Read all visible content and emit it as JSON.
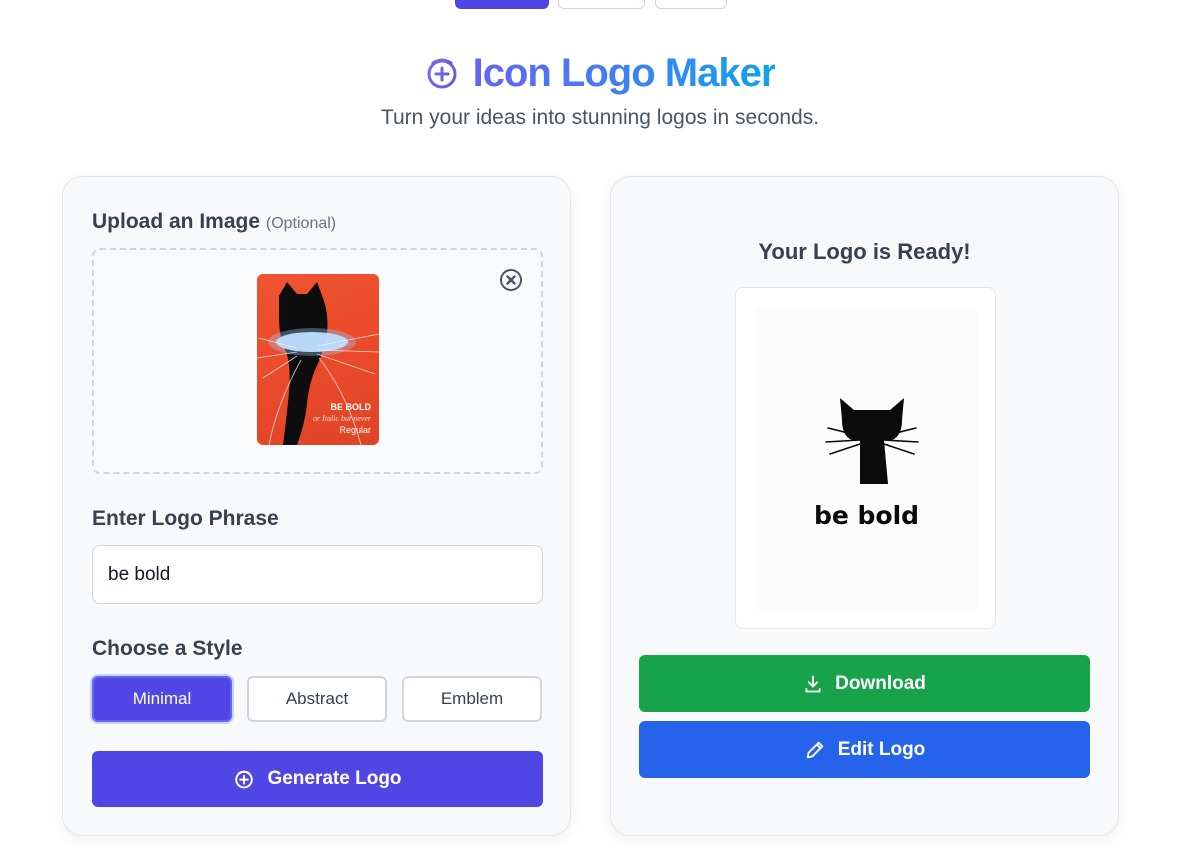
{
  "app": {
    "title": "Icon Logo Maker",
    "subtitle": "Turn your ideas into stunning logos in seconds."
  },
  "upload": {
    "label": "Upload an Image",
    "optional": "(Optional)",
    "thumbnail_text": {
      "line1": "BE BOLD",
      "line2": "or Italic but never",
      "line3": "Regular"
    }
  },
  "phrase": {
    "label": "Enter Logo Phrase",
    "value": "be bold"
  },
  "style": {
    "label": "Choose a Style",
    "options": [
      "Minimal",
      "Abstract",
      "Emblem"
    ],
    "selected": "Minimal"
  },
  "generate": {
    "label": "Generate Logo"
  },
  "result": {
    "title": "Your Logo is Ready!",
    "logo_text": "be bold",
    "download_label": "Download",
    "edit_label": "Edit Logo"
  },
  "colors": {
    "primary": "#4f46e5",
    "download": "#16a34a",
    "edit": "#2563eb",
    "title_gradient_start": "#6366f1",
    "title_gradient_end": "#0ea5e9"
  },
  "icons": {
    "title": "logo-plus-icon",
    "remove": "close-circle-icon",
    "generate": "logo-plus-icon",
    "download": "download-icon",
    "edit": "pencil-icon"
  }
}
